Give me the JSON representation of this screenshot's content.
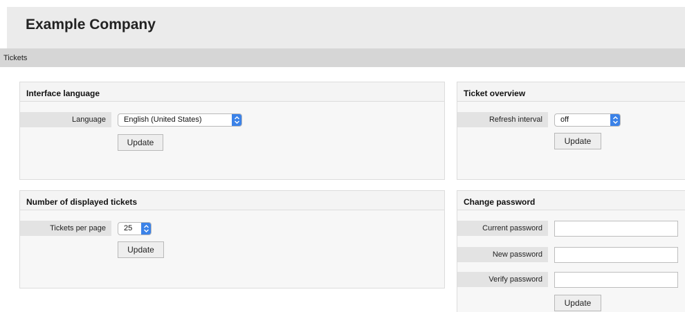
{
  "header": {
    "company_name": "Example Company"
  },
  "nav": {
    "items": [
      {
        "label": "Tickets"
      }
    ]
  },
  "interface_language": {
    "title": "Interface language",
    "language_label": "Language",
    "language_value": "English (United States)",
    "update_label": "Update"
  },
  "ticket_overview": {
    "title": "Ticket overview",
    "refresh_label": "Refresh interval",
    "refresh_value": "off",
    "update_label": "Update"
  },
  "displayed_tickets": {
    "title": "Number of displayed tickets",
    "per_page_label": "Tickets per page",
    "per_page_value": "25",
    "update_label": "Update"
  },
  "change_password": {
    "title": "Change password",
    "current_label": "Current password",
    "current_value": "",
    "new_label": "New password",
    "new_value": "",
    "verify_label": "Verify password",
    "verify_value": "",
    "update_label": "Update"
  },
  "colors": {
    "header_bg": "#ebebeb",
    "nav_bg": "#d6d6d6",
    "select_accent": "#3b82e8",
    "label_bg": "#e3e3e3"
  },
  "icons": {
    "select_arrow": "chevron-updown-icon"
  }
}
